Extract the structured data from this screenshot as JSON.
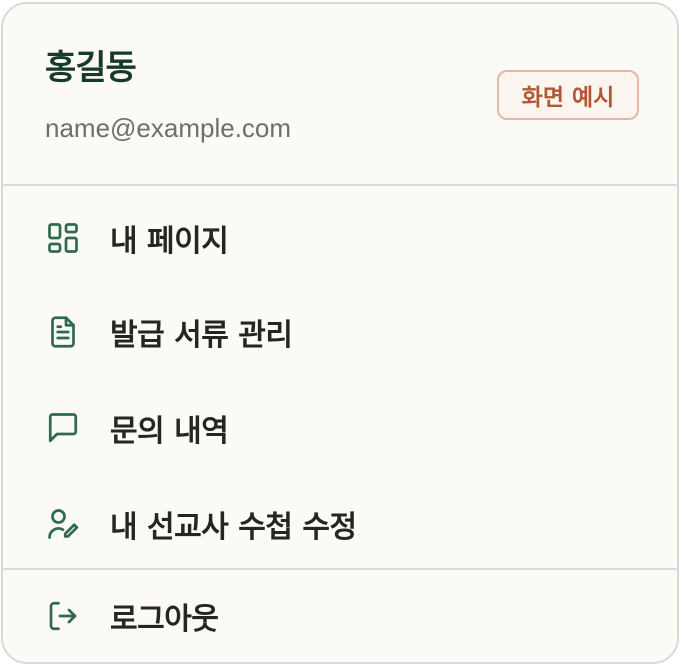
{
  "user": {
    "name": "홍길동",
    "email": "name@example.com"
  },
  "badge": {
    "label": "화면 예시",
    "text_color": "#b25733",
    "border_color": "#e3b9a6"
  },
  "menu": {
    "items": [
      {
        "label": "내 페이지",
        "icon": "dashboard-icon"
      },
      {
        "label": "발급 서류 관리",
        "icon": "document-icon"
      },
      {
        "label": "문의 내역",
        "icon": "chat-icon"
      },
      {
        "label": "내 선교사 수첩 수정",
        "icon": "user-edit-icon"
      }
    ]
  },
  "footer": {
    "logout_label": "로그아웃",
    "icon": "logout-icon"
  },
  "colors": {
    "accent": "#2f6a4c",
    "background": "#fbfaf6",
    "divider": "#d7dcd8"
  }
}
